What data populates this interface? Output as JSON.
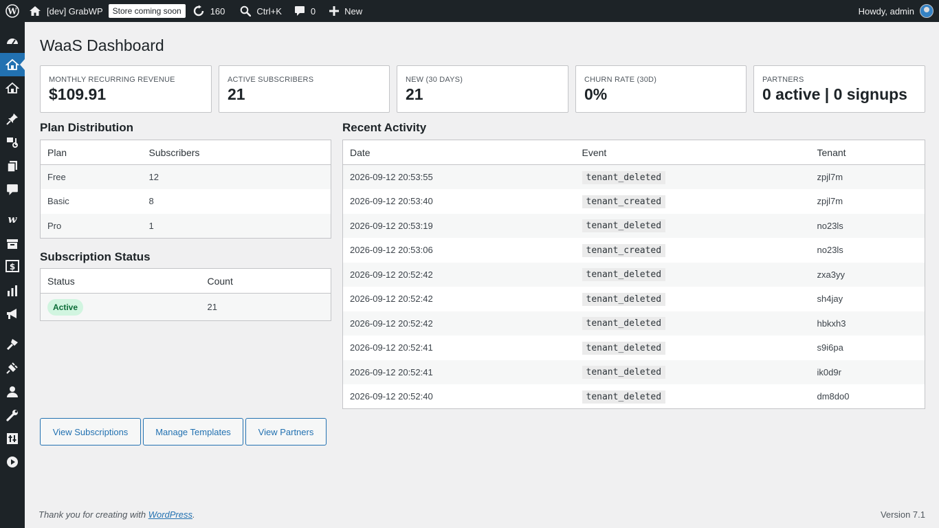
{
  "adminbar": {
    "site_name": "[dev] GrabWP",
    "coming_soon": "Store coming soon",
    "updates_count": "160",
    "search_shortcut": "Ctrl+K",
    "comments_count": "0",
    "new_label": "New",
    "howdy": "Howdy, admin"
  },
  "menu_icons": [
    "dashboard-icon",
    "waas-icon",
    "waas-templates-icon",
    "posts-pin-icon",
    "media-icon",
    "pages-icon",
    "comments-icon",
    "woocommerce-icon",
    "products-icon",
    "payments-icon",
    "analytics-icon",
    "marketing-icon",
    "appearance-icon",
    "plugins-icon",
    "users-icon",
    "tools-icon",
    "settings-icon",
    "media-player-icon"
  ],
  "page": {
    "title": "WaaS Dashboard"
  },
  "stats": [
    {
      "label": "Monthly Recurring Revenue",
      "value": "$109.91"
    },
    {
      "label": "Active Subscribers",
      "value": "21"
    },
    {
      "label": "New (30 days)",
      "value": "21"
    },
    {
      "label": "Churn Rate (30d)",
      "value": "0%"
    },
    {
      "label": "Partners",
      "value": "0 active | 0 signups"
    }
  ],
  "plan_distribution": {
    "title": "Plan Distribution",
    "headers": [
      "Plan",
      "Subscribers"
    ],
    "rows": [
      [
        "Free",
        "12"
      ],
      [
        "Basic",
        "8"
      ],
      [
        "Pro",
        "1"
      ]
    ]
  },
  "subscription_status": {
    "title": "Subscription Status",
    "headers": [
      "Status",
      "Count"
    ],
    "rows": [
      [
        "Active",
        "21"
      ]
    ]
  },
  "recent_activity": {
    "title": "Recent Activity",
    "headers": [
      "Date",
      "Event",
      "Tenant"
    ],
    "rows": [
      [
        "2026-09-12 20:53:55",
        "tenant_deleted",
        "zpjl7m"
      ],
      [
        "2026-09-12 20:53:40",
        "tenant_created",
        "zpjl7m"
      ],
      [
        "2026-09-12 20:53:19",
        "tenant_deleted",
        "no23ls"
      ],
      [
        "2026-09-12 20:53:06",
        "tenant_created",
        "no23ls"
      ],
      [
        "2026-09-12 20:52:42",
        "tenant_deleted",
        "zxa3yy"
      ],
      [
        "2026-09-12 20:52:42",
        "tenant_deleted",
        "sh4jay"
      ],
      [
        "2026-09-12 20:52:42",
        "tenant_deleted",
        "hbkxh3"
      ],
      [
        "2026-09-12 20:52:41",
        "tenant_deleted",
        "s9i6pa"
      ],
      [
        "2026-09-12 20:52:41",
        "tenant_deleted",
        "ik0d9r"
      ],
      [
        "2026-09-12 20:52:40",
        "tenant_deleted",
        "dm8do0"
      ]
    ]
  },
  "actions": {
    "view_subscriptions": "View Subscriptions",
    "manage_templates": "Manage Templates",
    "view_partners": "View Partners"
  },
  "footer": {
    "thanks_prefix": "Thank you for creating with ",
    "wordpress_link": "WordPress",
    "thanks_suffix": ".",
    "version": "Version 7.1"
  },
  "colors": {
    "adminbar_bg": "#1d2327",
    "accent": "#2271b1",
    "active_badge_bg": "#d1f5e0",
    "page_bg": "#f0f0f1"
  }
}
